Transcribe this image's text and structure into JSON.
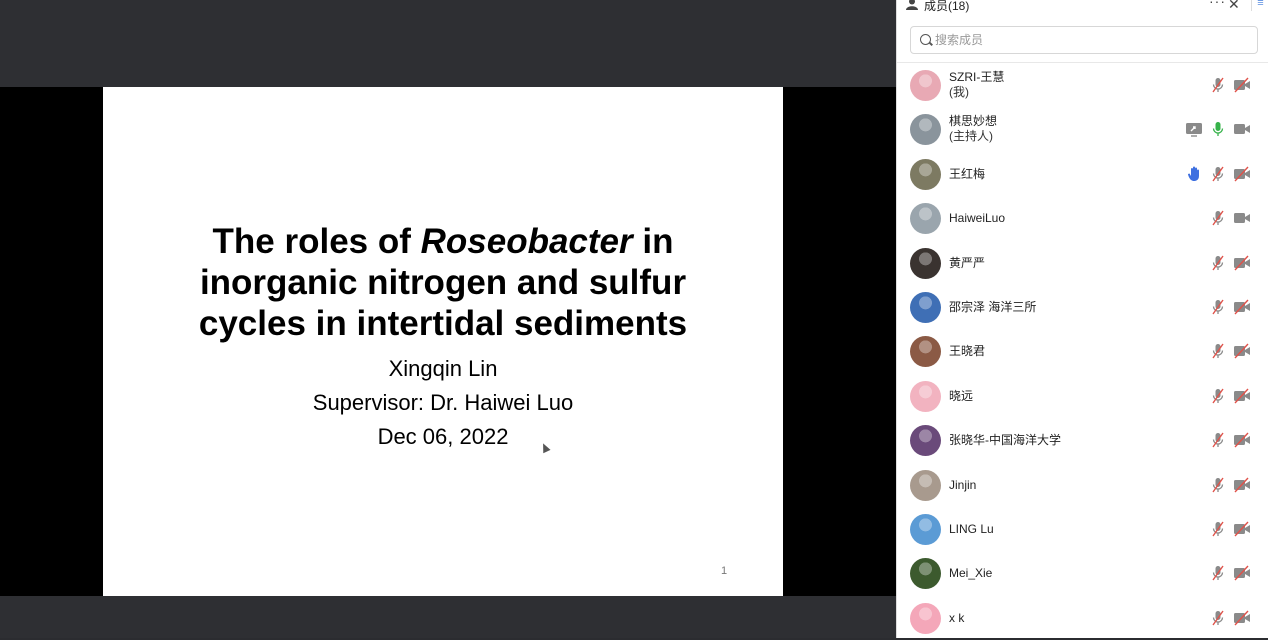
{
  "slide": {
    "title_line1_pre": "The roles of ",
    "title_line1_italic": "Roseobacter",
    "title_line1_post": " in",
    "title_line2": "inorganic nitrogen and sulfur",
    "title_line3": "cycles in intertidal sediments",
    "author": "Xingqin Lin",
    "supervisor": "Supervisor: Dr. Haiwei Luo",
    "date": "Dec 06, 2022",
    "page_number": "1"
  },
  "panel": {
    "title": "成员(18)",
    "more_label": "···",
    "close_label": "✕",
    "side_menu_label": "≡",
    "search_placeholder": "搜索成员"
  },
  "members": [
    {
      "name": "SZRI-王慧",
      "role": "(我)",
      "avatar_color": "#e8a9b4",
      "share": false,
      "hand": false,
      "mic": "muted",
      "cam": "off"
    },
    {
      "name": "棋思妙想",
      "role": "(主持人)",
      "avatar_color": "#8a949c",
      "share": true,
      "hand": false,
      "mic": "on",
      "cam": "on"
    },
    {
      "name": "王红梅",
      "role": "",
      "avatar_color": "#7d7a62",
      "share": false,
      "hand": true,
      "mic": "muted",
      "cam": "off"
    },
    {
      "name": "HaiweiLuo",
      "role": "",
      "avatar_color": "#9aa5ad",
      "share": false,
      "hand": false,
      "mic": "muted",
      "cam": "on"
    },
    {
      "name": "黄严严",
      "role": "",
      "avatar_color": "#3a3330",
      "share": false,
      "hand": false,
      "mic": "muted",
      "cam": "off"
    },
    {
      "name": "邵宗泽 海洋三所",
      "role": "",
      "avatar_color": "#3f6fb5",
      "share": false,
      "hand": false,
      "mic": "muted",
      "cam": "off"
    },
    {
      "name": "王晓君",
      "role": "",
      "avatar_color": "#8b5a45",
      "share": false,
      "hand": false,
      "mic": "muted",
      "cam": "off"
    },
    {
      "name": "晓远",
      "role": "",
      "avatar_color": "#f2b3c0",
      "share": false,
      "hand": false,
      "mic": "muted",
      "cam": "off"
    },
    {
      "name": "张晓华-中国海洋大学",
      "role": "",
      "avatar_color": "#6a4a7a",
      "share": false,
      "hand": false,
      "mic": "muted",
      "cam": "off"
    },
    {
      "name": "Jinjin",
      "role": "",
      "avatar_color": "#a89a8e",
      "share": false,
      "hand": false,
      "mic": "muted",
      "cam": "off"
    },
    {
      "name": "LING Lu",
      "role": "",
      "avatar_color": "#5b9bd5",
      "share": false,
      "hand": false,
      "mic": "muted",
      "cam": "off"
    },
    {
      "name": "Mei_Xie",
      "role": "",
      "avatar_color": "#3c5a2e",
      "share": false,
      "hand": false,
      "mic": "muted",
      "cam": "off"
    },
    {
      "name": "x k",
      "role": "",
      "avatar_color": "#f4a7b9",
      "share": false,
      "hand": false,
      "mic": "muted",
      "cam": "off"
    }
  ],
  "colors": {
    "mic_on": "#36b24a",
    "hand": "#3d6fe0",
    "icon_gray": "#8a8a8a"
  }
}
